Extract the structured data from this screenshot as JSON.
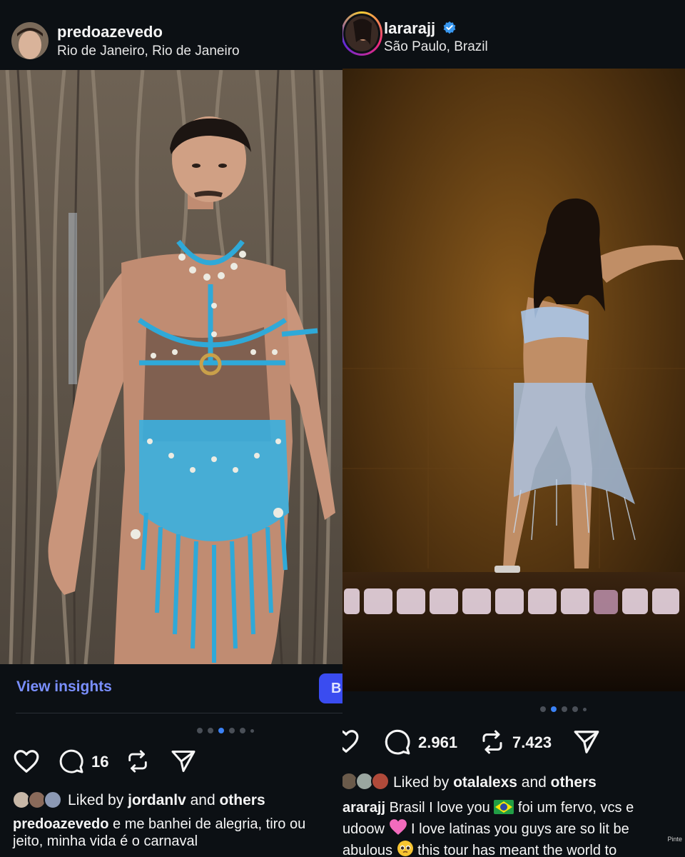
{
  "left_post": {
    "username": "predoazevedo",
    "location": "Rio de Janeiro, Rio de Janeiro",
    "photo_alt": "Man wearing blue macramé outfit with pearls and shells in front of tree roots",
    "view_insights": "View insights",
    "boost_label": "B",
    "carousel": {
      "count": 6,
      "active_index": 2
    },
    "comments_count": "16",
    "liked_by_prefix": "Liked by ",
    "liked_by_user": "jordanlv",
    "liked_by_and": " and ",
    "liked_by_others": "others",
    "caption_username": "predoazevedo",
    "caption_line1": " e me banhei de alegria, tiro ou",
    "caption_line2": "jeito, minha vida é o carnaval"
  },
  "right_post": {
    "username": "lararajj",
    "verified": true,
    "location": "São Paulo, Brazil",
    "photo_alt": "Performer in blue crochet outfit posing on stage",
    "carousel": {
      "count": 5,
      "active_index": 1
    },
    "comments_count": "2.961",
    "reposts_count": "7.423",
    "liked_by_prefix": "Liked by ",
    "liked_by_user": "otalalexs",
    "liked_by_and": " and ",
    "liked_by_others": "others",
    "caption_username": "ararajj",
    "caption_line1": " Brasil I love you ",
    "caption_line1_end": " foi um fervo, vcs e",
    "caption_line2_start": "udoow ",
    "caption_line2_end": " I love latinas you guys are so lit be",
    "caption_line3_start": "abulous ",
    "caption_line3_end": " this tour has meant the world to",
    "watermark": "Pinte"
  },
  "colors": {
    "background": "#0c1014",
    "link": "#7a8fff",
    "carousel_active": "#3b82f6",
    "verified": "#3897f0"
  }
}
